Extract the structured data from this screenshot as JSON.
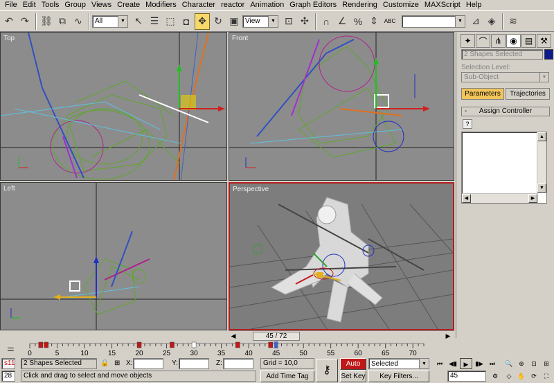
{
  "menu": [
    "File",
    "Edit",
    "Tools",
    "Group",
    "Views",
    "Create",
    "Modifiers",
    "Character",
    "reactor",
    "Animation",
    "Graph Editors",
    "Rendering",
    "Customize",
    "MAXScript",
    "Help"
  ],
  "toolbar": {
    "selection_filter": "All",
    "ref_coord": "View",
    "abc_label": "ABC",
    "named_selection": ""
  },
  "viewports": {
    "top": "Top",
    "front": "Front",
    "left": "Left",
    "perspective": "Perspective"
  },
  "command_panel": {
    "object_name": "2 Shapes Selected",
    "selection_level_label": "Selection Level:",
    "sub_object": "Sub-Object",
    "tab_parameters": "Parameters",
    "tab_trajectories": "Trajectories",
    "rollout_title": "Assign Controller",
    "rollout_toggle": "-",
    "swatch_color": "#0b1a8c"
  },
  "time_slider": {
    "frame_display": "45 / 72",
    "current_frame": 45,
    "total_frames": 72
  },
  "trackbar": {
    "ticks": [
      "0",
      "5",
      "10",
      "15",
      "20",
      "25",
      "30",
      "35",
      "40",
      "45",
      "50",
      "55",
      "60",
      "65",
      "70"
    ],
    "keys": [
      2,
      3,
      20,
      26,
      30,
      38,
      44
    ]
  },
  "status": {
    "maxscript_label": "s11",
    "frame_field": "28",
    "selection_status": "2 Shapes Selected",
    "prompt": "Click and drag to select and move objects",
    "x_label": "X:",
    "y_label": "Y:",
    "z_label": "Z:",
    "x_value": "",
    "y_value": "",
    "z_value": "",
    "grid": "Grid = 10,0",
    "add_time_tag": "Add Time Tag",
    "auto_key": "Auto Key",
    "set_key": "Set Key",
    "key_mode": "Selected",
    "key_filters": "Key Filters...",
    "frame_spinner": "45"
  }
}
